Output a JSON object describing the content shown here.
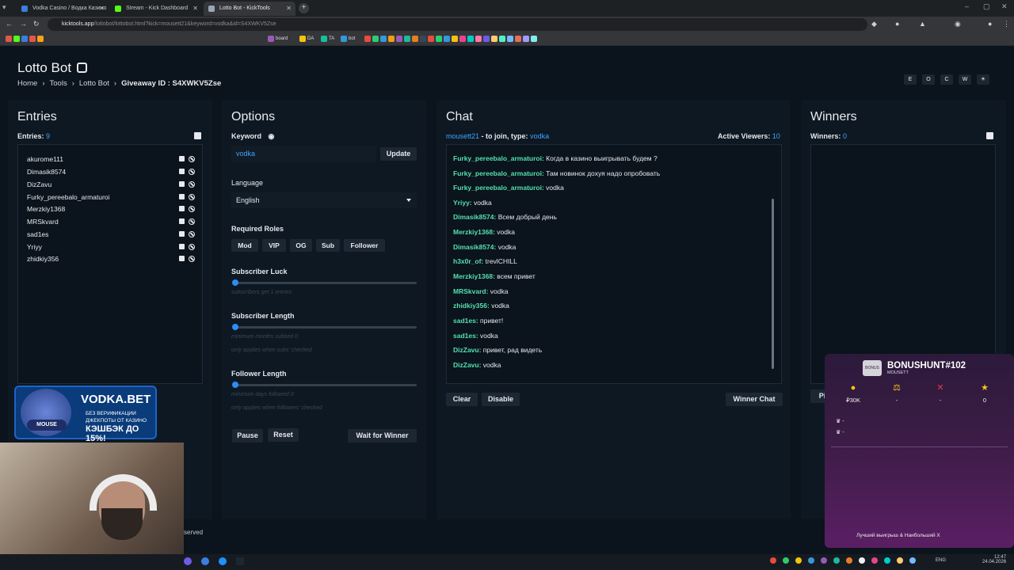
{
  "browser": {
    "tabs": [
      {
        "label": "Vodka Casino / Водка Казино"
      },
      {
        "label": "Stream - Kick Dashboard"
      },
      {
        "label": "Lotto Bot - KickTools"
      }
    ],
    "url_host": "kicktools.app",
    "url_path": "/lottobot/lottobot.html?kick=mousett21&keyword=vodka&id=S4XWKV5Zse",
    "bookmarks": [
      "board",
      "DA",
      "TA",
      "bot"
    ]
  },
  "page": {
    "title": "Lotto Bot",
    "breadcrumb": [
      "Home",
      "Tools",
      "Lotto Bot"
    ],
    "giveaway_label": "Giveaway ID :",
    "giveaway_id": "S4XWKV5Zse",
    "top_buttons": [
      "E",
      "O",
      "C",
      "W",
      "☀"
    ]
  },
  "entries": {
    "title": "Entries",
    "count_label": "Entries:",
    "count": "9",
    "items": [
      "akurome111",
      "Dimasik8574",
      "DizZavu",
      "Furky_pereebalo_armaturoi",
      "Merzkiy1368",
      "MRSkvard",
      "sad1es",
      "Yriyy",
      "zhidkiy356"
    ]
  },
  "options": {
    "title": "Options",
    "keyword_label": "Keyword",
    "keyword_value": "vodka",
    "update_label": "Update",
    "language_label": "Language",
    "language_value": "English",
    "roles_label": "Required Roles",
    "roles": [
      "Mod",
      "VIP",
      "OG",
      "Sub",
      "Follower"
    ],
    "sub_luck_label": "Subscriber Luck",
    "sub_luck_hint": "subscribers get 1 entries",
    "sub_length_label": "Subscriber Length",
    "sub_length_hint1": "minimum months subbed 0",
    "sub_length_hint2": "only applies when subs' checked",
    "follower_length_label": "Follower Length",
    "follower_length_hint1": "minimum days followed 0",
    "follower_length_hint2": "only applies when followers' checked",
    "pause_label": "Pause",
    "reset_label": "Reset",
    "wait_label": "Wait for Winner"
  },
  "chat": {
    "title": "Chat",
    "join_user": "mousett21",
    "join_text": "- to join, type:",
    "join_keyword": "vodka",
    "viewers_label": "Active Viewers:",
    "viewers": "10",
    "messages": [
      {
        "user": "Furky_pereebalo_armaturoi:",
        "text": "Когда в казино выигрывать будем ?"
      },
      {
        "user": "Furky_pereebalo_armaturoi:",
        "text": "Там новинок дохуя надо опробовать"
      },
      {
        "user": "Furky_pereebalo_armaturoi:",
        "text": "vodka"
      },
      {
        "user": "Yriyy:",
        "text": "vodka"
      },
      {
        "user": "Dimasik8574:",
        "text": "Всем добрый день"
      },
      {
        "user": "Merzkiy1368:",
        "text": "vodka"
      },
      {
        "user": "Dimasik8574:",
        "text": "vodka"
      },
      {
        "user": "h3x0r_of:",
        "text": "trevlCHILL"
      },
      {
        "user": "Merzkiy1368:",
        "text": "всем привет"
      },
      {
        "user": "MRSkvard:",
        "text": "vodka"
      },
      {
        "user": "zhidkiy356:",
        "text": "vodka"
      },
      {
        "user": "sad1es:",
        "text": "привет!"
      },
      {
        "user": "sad1es:",
        "text": "vodka"
      },
      {
        "user": "DizZavu:",
        "text": "привет, рад видеть"
      },
      {
        "user": "DizZavu:",
        "text": "vodka"
      }
    ],
    "clear_label": "Clear",
    "disable_label": "Disable",
    "winner_chat_label": "Winner Chat"
  },
  "winners": {
    "title": "Winners",
    "count_label": "Winners:",
    "count": "0",
    "pick_label": "Pi"
  },
  "bonushunt": {
    "logo": "BONUS",
    "title": "BONUSHUNT#102",
    "subtitle": "MOUSETT",
    "stats": [
      {
        "icon": "coin-icon",
        "value": "₽30K"
      },
      {
        "icon": "scale-icon",
        "value": "-"
      },
      {
        "icon": "cross-icon",
        "value": "-"
      },
      {
        "icon": "star-icon",
        "value": "0"
      }
    ],
    "rows": [
      "-",
      "-"
    ],
    "footer": "Лучший выигрыш & Наибольший X"
  },
  "ad": {
    "brand": "VODKA.BET",
    "line1": "БЕЗ ВЕРИФИКАЦИИ",
    "line2": "ДЖЕКПОТЫ ОТ КАЗИНО",
    "line3": "КЭШБЭК ДО 15%!",
    "tag": "MOUSE"
  },
  "footer_text": "served",
  "taskbar": {
    "lang": "ENG",
    "time": "12:47",
    "date": "24.04.2026"
  }
}
